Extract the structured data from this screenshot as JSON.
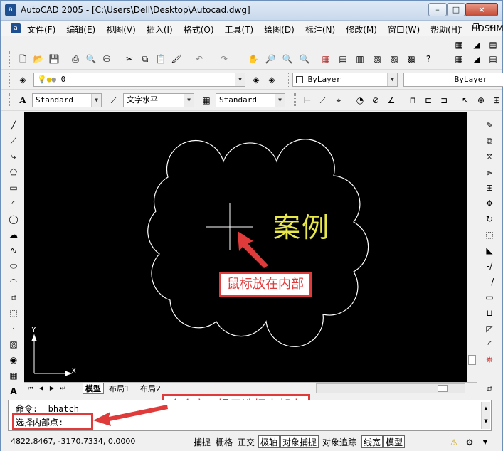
{
  "window": {
    "title": "AutoCAD 2005 - [C:\\Users\\Dell\\Desktop\\Autocad.dwg]",
    "app_icon_glyph": "a",
    "controls": {
      "minimize": "–",
      "maximize": "□",
      "close": "×"
    }
  },
  "menubar": {
    "doc_icon_glyph": "a",
    "items": [
      "文件(F)",
      "编辑(E)",
      "视图(V)",
      "插入(I)",
      "格式(O)",
      "工具(T)",
      "绘图(D)",
      "标注(N)",
      "修改(M)",
      "窗口(W)",
      "帮助(H)",
      "HDSHM"
    ]
  },
  "toolbars": {
    "layer_value": "0",
    "color_value": "ByLayer",
    "linetype_value": "ByLayer",
    "text_style": "Standard",
    "font_name": "文字水平",
    "dim_style": "Standard"
  },
  "canvas": {
    "sample_text": "案例",
    "ucs_y": "Y",
    "ucs_x": "X",
    "colors": {
      "background": "#000000",
      "cloud": "#ffffff",
      "text": "#e8e84a"
    }
  },
  "layout_tabs": [
    "模型",
    "布局1",
    "布局2"
  ],
  "command": {
    "line1": "命令:   _bhatch",
    "line2": "选择内部点:"
  },
  "statusbar": {
    "coords": "4822.8467,  -3170.7334,  0.0000",
    "buttons": [
      {
        "label": "捕捉",
        "on": false
      },
      {
        "label": "栅格",
        "on": false
      },
      {
        "label": "正交",
        "on": false
      },
      {
        "label": "极轴",
        "on": true
      },
      {
        "label": "对象捕捉",
        "on": true
      },
      {
        "label": "对象追踪",
        "on": false
      },
      {
        "label": "线宽",
        "on": true
      },
      {
        "label": "模型",
        "on": true
      }
    ]
  },
  "annotations": {
    "mouse_hint": "鼠标放在内部",
    "command_hint": "命令窗口提示选择内部点",
    "color": "#e03b3b"
  }
}
